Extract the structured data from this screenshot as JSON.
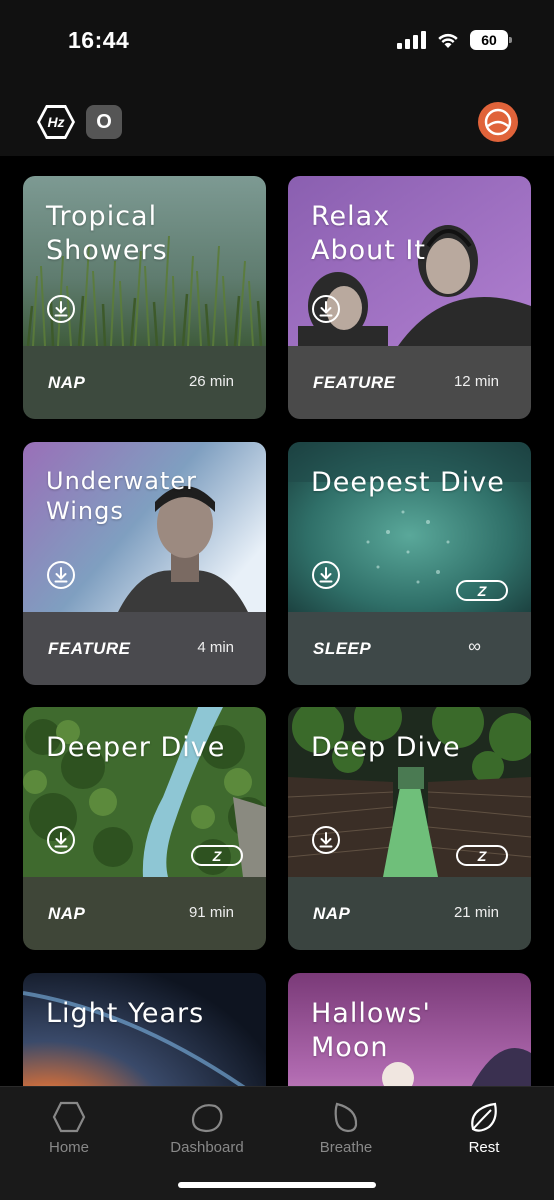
{
  "status_bar": {
    "time": "16:44",
    "battery": "60"
  },
  "header": {
    "hz_label": "Hz",
    "o_label": "O"
  },
  "cards": [
    {
      "title": "Tropical\nShowers",
      "category": "NAP",
      "duration": "26 min",
      "has_z": false
    },
    {
      "title": "Relax\nAbout It",
      "category": "FEATURE",
      "duration": "12 min",
      "has_z": false
    },
    {
      "title": "Underwater\nWings",
      "category": "FEATURE",
      "duration": "4 min",
      "has_z": false
    },
    {
      "title": "Deepest Dive",
      "category": "SLEEP",
      "duration": "∞",
      "has_z": true
    },
    {
      "title": "Deeper Dive",
      "category": "NAP",
      "duration": "91 min",
      "has_z": true
    },
    {
      "title": "Deep Dive",
      "category": "NAP",
      "duration": "21 min",
      "has_z": true
    },
    {
      "title": "Light Years",
      "category": "",
      "duration": "",
      "has_z": false
    },
    {
      "title": "Hallows'\nMoon",
      "category": "",
      "duration": "",
      "has_z": false
    }
  ],
  "z_badge": "Z",
  "tabs": [
    {
      "label": "Home",
      "icon": "hexagon-icon"
    },
    {
      "label": "Dashboard",
      "icon": "blob-icon"
    },
    {
      "label": "Breathe",
      "icon": "leaf-outline-icon"
    },
    {
      "label": "Rest",
      "icon": "leaf-icon"
    }
  ],
  "active_tab": "Rest",
  "colors": {
    "accent_profile": "#e0633a",
    "background": "#000000",
    "tab_bar": "#1a1a1a",
    "inactive_tab": "#888888"
  }
}
